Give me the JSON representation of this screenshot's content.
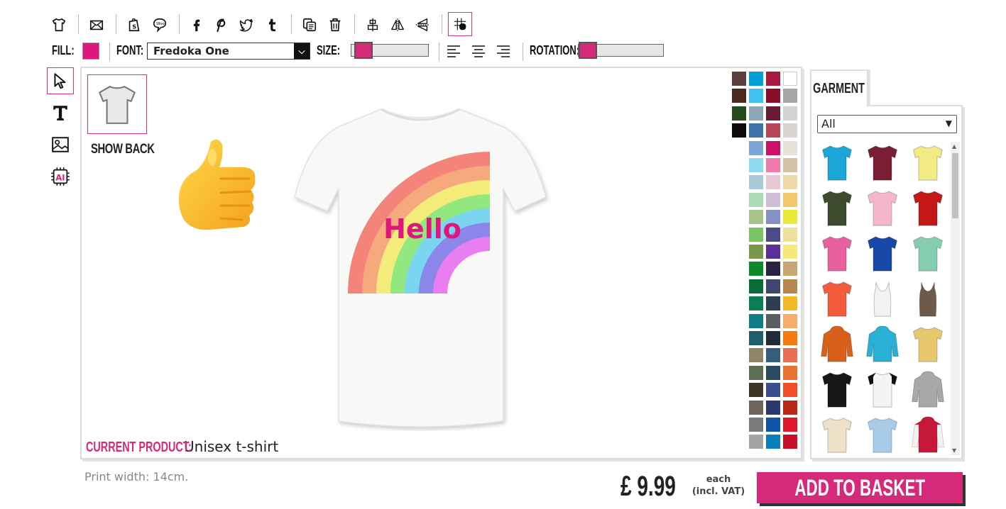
{
  "toolbar": {
    "buttons": [
      {
        "name": "tshirt-icon"
      },
      {
        "name": "email-icon"
      },
      {
        "name": "shopify-icon"
      },
      {
        "name": "chat-bubble-icon"
      },
      {
        "name": "facebook-icon"
      },
      {
        "name": "pinterest-icon"
      },
      {
        "name": "twitter-icon"
      },
      {
        "name": "tumblr-icon"
      },
      {
        "name": "duplicate-icon"
      },
      {
        "name": "trash-icon"
      },
      {
        "name": "align-center-vertical-icon"
      },
      {
        "name": "flip-horizontal-icon"
      },
      {
        "name": "flip-vertical-icon"
      },
      {
        "name": "grid-snap-icon"
      }
    ]
  },
  "properties": {
    "fill_label": "FILL:",
    "fill_color": "#e0167f",
    "font_label": "FONT:",
    "font_value": "Fredoka One",
    "size_label": "SIZE:",
    "size_value": 0.05,
    "rotation_label": "ROTATION:",
    "rotation_value": 0.0
  },
  "left_tools": [
    "select-pointer-icon",
    "text-tool-icon",
    "image-tool-icon",
    "ai-tool-icon"
  ],
  "canvas": {
    "show_back_label": "SHOW BACK",
    "current_product_label": "CURRENT PRODUCT:",
    "current_product_value": "Unisex t-shirt",
    "design_text": "Hello",
    "design_text_color": "#e0167f",
    "shirt_color": "#f8f8f6"
  },
  "colors": [
    "#5b3f3f",
    "#00a0d6",
    "#a8193f",
    "#ffffff",
    "#4a2a1c",
    "#3fc2ef",
    "#8a0e2a",
    "#a6a6a6",
    "#244a1e",
    "#8fa6b8",
    "#6a1b35",
    "#d3d3d3",
    "#0a0a0a",
    "#3a74a8",
    "#b84657",
    "#d8d4cf",
    "#7aa7d8",
    "#cc1065",
    "#e7e2d8",
    "#8fdcf0",
    "#f07aab",
    "#d2c3a8",
    "#a9c8d8",
    "#e8c8d4",
    "#ecd8a8",
    "#a9dcb6",
    "#cfbed8",
    "#f2c86a",
    "#a8c48a",
    "#8790c4",
    "#eaea3a",
    "#7ac464",
    "#4d4a8a",
    "#ede29a",
    "#78994a",
    "#5b2f9a",
    "#f6e97a",
    "#0a8a2a",
    "#2a2440",
    "#c8a574",
    "#0a6e3a",
    "#404870",
    "#b8874c",
    "#0a7e54",
    "#2c3e50",
    "#f4b828",
    "#0e7e86",
    "#5a5e60",
    "#f8ac6a",
    "#1e5e6e",
    "#222c38",
    "#f47a10",
    "#8e8468",
    "#365e7a",
    "#ec6e50",
    "#5e6e50",
    "#2a4a5e",
    "#e87430",
    "#3e3624",
    "#3a4e8e",
    "#f04e2a",
    "#6e645c",
    "#2a3a6e",
    "#b82814",
    "#7a7a7a",
    "#0e54a8",
    "#e0182a",
    "#a4a4a4",
    "#0a7eb8",
    "#c8102a"
  ],
  "garment": {
    "tab_label": "GARMENT",
    "filter_value": "All",
    "items": [
      {
        "name": "tshirt-cyan",
        "color": "#1aa6d6"
      },
      {
        "name": "tshirt-maroon",
        "color": "#7a1e35"
      },
      {
        "name": "tshirt-yellow",
        "color": "#f2ea82"
      },
      {
        "name": "tshirt-olive",
        "color": "#3e4a2e"
      },
      {
        "name": "tshirt-pink",
        "color": "#f4b6cc"
      },
      {
        "name": "tshirt-red",
        "color": "#c41818"
      },
      {
        "name": "womens-tshirt-pink",
        "color": "#e8609e"
      },
      {
        "name": "tshirt-royal-blue",
        "color": "#1848a8"
      },
      {
        "name": "tshirt-mint",
        "color": "#84cdb0"
      },
      {
        "name": "womens-tshirt-coral",
        "color": "#f45a3c"
      },
      {
        "name": "tank-top-white",
        "color": "#f2f2f2"
      },
      {
        "name": "tank-top-brown",
        "color": "#6e5a4a"
      },
      {
        "name": "hoodie-orange",
        "color": "#d8601a"
      },
      {
        "name": "hoodie-turquoise",
        "color": "#2ab0d4"
      },
      {
        "name": "tshirt-tie-dye",
        "color": "#e8c86e"
      },
      {
        "name": "tshirt-black",
        "color": "#161616"
      },
      {
        "name": "raglan-black-white",
        "color": "#f4f4f4"
      },
      {
        "name": "hoodie-grey",
        "color": "#a8a8a8"
      },
      {
        "name": "tshirt-natural",
        "color": "#efe0c8"
      },
      {
        "name": "tshirt-dip-dye-blue",
        "color": "#a8cce8"
      },
      {
        "name": "varsity-jacket-red",
        "color": "#c8183a"
      }
    ]
  },
  "footer": {
    "print_width": "Print width: 14cm.",
    "price": "£ 9.99",
    "each_line1": "each",
    "each_line2": "(incl. VAT)",
    "basket_label": "ADD TO BASKET"
  }
}
